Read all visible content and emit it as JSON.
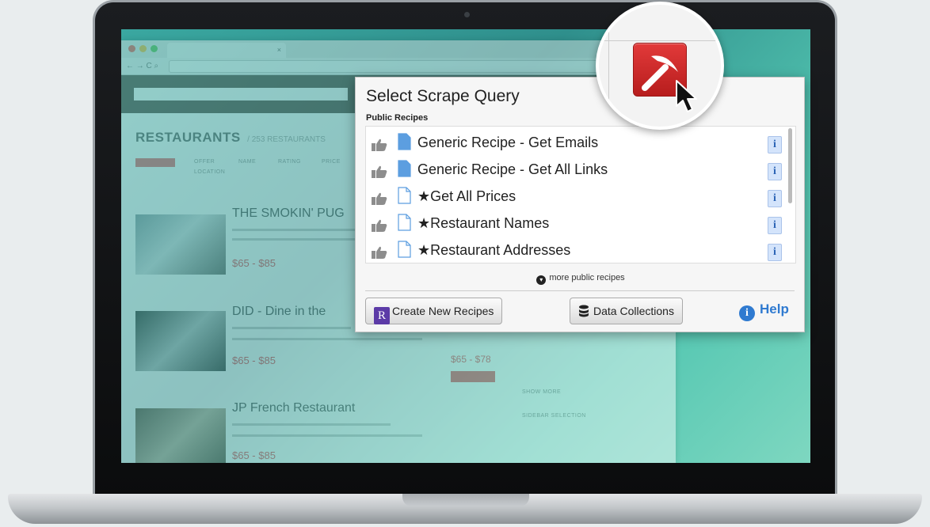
{
  "browser": {
    "tab_title": "×",
    "nav_icons": "←  →  C  ⌕"
  },
  "site": {
    "page_title": "RESTAURANTS",
    "count_text": "/ 253 RESTAURANTS",
    "sort_labels": [
      "OFFER",
      "NAME",
      "RATING",
      "PRICE",
      "LOCATION"
    ],
    "restaurants": [
      {
        "name": "THE SMOKIN' PUG",
        "price": "$65 - $85"
      },
      {
        "name": "DID - Dine in the",
        "price": "$65 - $85",
        "side_price": "$65 - $78"
      },
      {
        "name": "JP French Restaurant",
        "price": "$65 - $85"
      }
    ],
    "side_labels": [
      "SHOW MORE",
      "SIDEBAR SELECTION"
    ]
  },
  "popup": {
    "title": "Select Scrape Query",
    "section_label": "Public Recipes",
    "recipes": [
      {
        "label": "Generic Recipe - Get Emails",
        "doc_filled": true
      },
      {
        "label": "Generic Recipe - Get All Links",
        "doc_filled": true
      },
      {
        "label": "★Get All Prices",
        "doc_filled": false
      },
      {
        "label": "★Restaurant Names",
        "doc_filled": false
      },
      {
        "label": "★Restaurant Addresses",
        "doc_filled": false
      }
    ],
    "info_glyph": "i",
    "more_link": "more public recipes",
    "create_button": "Create New Recipes",
    "create_icon_glyph": "R",
    "collections_button": "Data Collections",
    "help_link": "Help"
  },
  "colors": {
    "extension_red": "#d32a2a",
    "help_blue": "#2f7ad0",
    "recipe_icon_purple": "#5c3ba7"
  },
  "icons": {
    "extension": "pickaxe-icon",
    "thumb": "thumbs-up-icon",
    "document": "document-icon",
    "info": "info-icon",
    "database": "database-icon",
    "more": "chevron-down-circle-icon",
    "cursor": "mouse-cursor-icon"
  }
}
